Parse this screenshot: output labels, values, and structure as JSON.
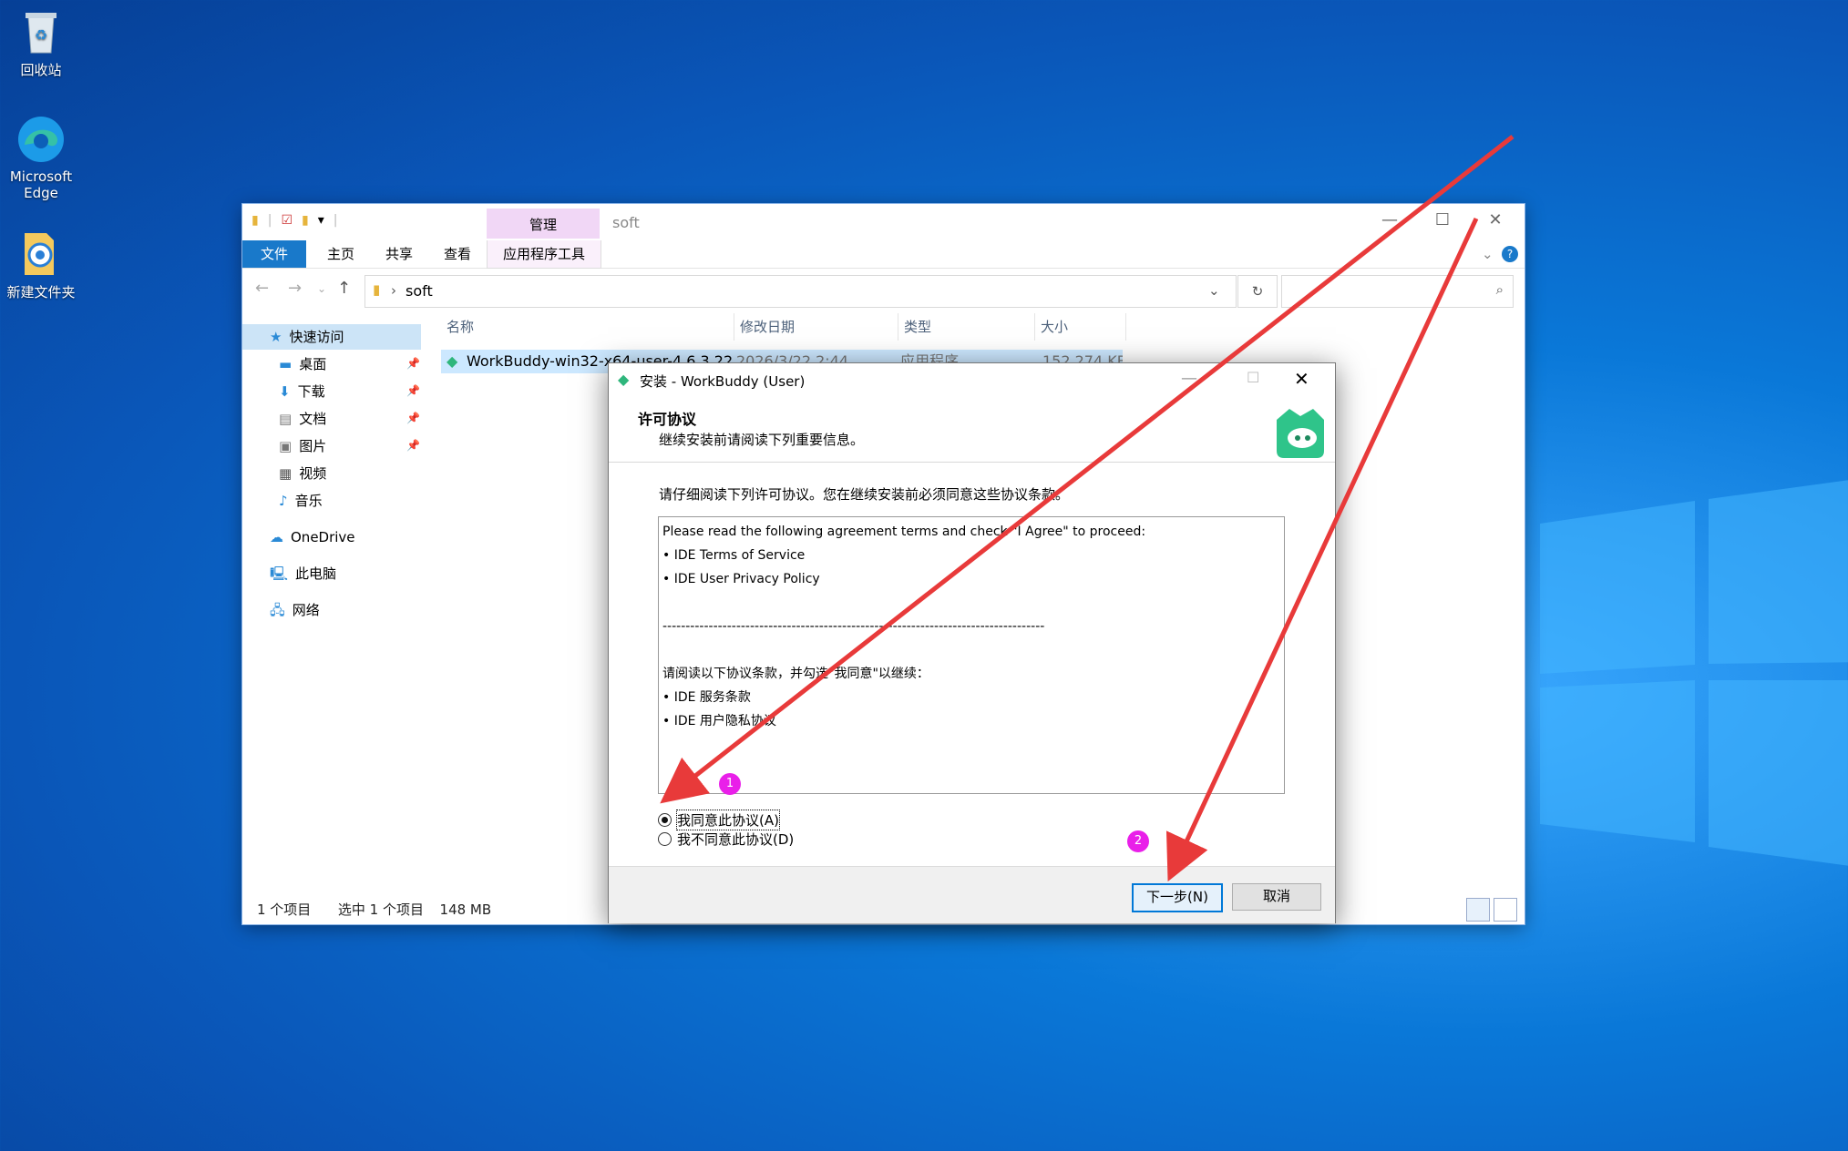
{
  "desktop": {
    "icons": [
      {
        "label": "回收站"
      },
      {
        "label": "Microsoft Edge"
      },
      {
        "label": "新建文件夹"
      }
    ]
  },
  "explorer": {
    "context_tab": "管理",
    "title": "soft",
    "ribbon_tabs": [
      "文件",
      "主页",
      "共享",
      "查看",
      "应用程序工具"
    ],
    "breadcrumb": "soft",
    "nav": {
      "quick_access": "快速访问",
      "items": [
        "桌面",
        "下载",
        "文档",
        "图片",
        "视频",
        "音乐"
      ],
      "onedrive": "OneDrive",
      "this_pc": "此电脑",
      "network": "网络"
    },
    "columns": [
      "名称",
      "修改日期",
      "类型",
      "大小"
    ],
    "file_row": {
      "name": "WorkBuddy-win32-x64-user-4.6.3.22",
      "date": "2026/3/22 2:44",
      "type": "应用程序",
      "size": "152,274 KB"
    },
    "status": {
      "count": "1 个项目",
      "selected": "选中 1 个项目",
      "size": "148 MB"
    }
  },
  "dialog": {
    "title": "安装 - WorkBuddy (User)",
    "heading": "许可协议",
    "subheading": "继续安装前请阅读下列重要信息。",
    "intro": "请仔细阅读下列许可协议。您在继续安装前必须同意这些协议条款。",
    "license_lines": [
      "Please read the following agreement terms and check \"I Agree\" to proceed:",
      "• IDE Terms of Service",
      "• IDE User Privacy Policy",
      "",
      "-----------------------------------------------------------------------------------------------------------------",
      "",
      "请阅读以下协议条款，并勾选\"我同意\"以继续：",
      "• IDE 服务条款",
      "• IDE 用户隐私协议"
    ],
    "radio_agree": "我同意此协议(A)",
    "radio_disagree": "我不同意此协议(D)",
    "next_button": "下一步(N)",
    "cancel_button": "取消"
  },
  "annotations": {
    "badge1": "1",
    "badge2": "2",
    "arrow_color": "#e83a3a",
    "badge_color": "#e91fe9"
  }
}
